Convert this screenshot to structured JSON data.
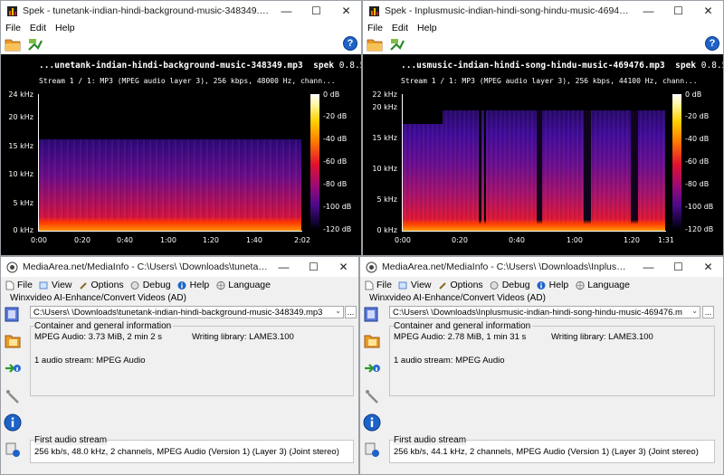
{
  "spek_left": {
    "title": "Spek - tunetank-indian-hindi-background-music-348349.mp3",
    "menu": [
      "File",
      "Edit",
      "Help"
    ],
    "file_header": "...unetank-indian-hindi-background-music-348349.mp3",
    "app_name": "spek",
    "version": "0.8.5",
    "stream_info": "Stream 1 / 1: MP3 (MPEG audio layer 3), 256 kbps, 48000 Hz, chann...",
    "y_ticks": [
      "24 kHz",
      "20 kHz",
      "15 kHz",
      "10 kHz",
      "5 kHz",
      "0 kHz"
    ],
    "x_ticks": [
      "0:00",
      "0:20",
      "0:40",
      "1:00",
      "1:20",
      "1:40",
      "2:02"
    ],
    "db_ticks": [
      "0 dB",
      "-20 dB",
      "-40 dB",
      "-60 dB",
      "-80 dB",
      "-100 dB",
      "-120 dB"
    ],
    "cutoff_khz": 16
  },
  "spek_right": {
    "title": "Spek - Inplusmusic-indian-hindi-song-hindu-music-469476.mp3",
    "menu": [
      "File",
      "Edit",
      "Help"
    ],
    "file_header": "...usmusic-indian-hindi-song-hindu-music-469476.mp3",
    "app_name": "spek",
    "version": "0.8.5",
    "stream_info": "Stream 1 / 1: MP3 (MPEG audio layer 3), 256 kbps, 44100 Hz, chann...",
    "y_ticks": [
      "22 kHz",
      "20 kHz",
      "15 kHz",
      "10 kHz",
      "5 kHz",
      "0 kHz"
    ],
    "x_ticks": [
      "0:00",
      "0:20",
      "0:40",
      "1:00",
      "1:20",
      "1:31"
    ],
    "db_ticks": [
      "0 dB",
      "-20 dB",
      "-40 dB",
      "-60 dB",
      "-80 dB",
      "-100 dB",
      "-120 dB"
    ],
    "cutoff_khz": 19.5
  },
  "mi_left": {
    "title": "MediaArea.net/MediaInfo - C:\\Users\\        \\Downloads\\tunetank-indi...",
    "menu": [
      "File",
      "View",
      "Options",
      "Debug",
      "Help",
      "Language"
    ],
    "ad": "Winxvideo AI-Enhance/Convert Videos (AD)",
    "path": "C:\\Users\\        \\Downloads\\tunetank-indian-hindi-background-music-348349.mp3",
    "general_title": "Container and general information",
    "general_line": "MPEG Audio: 3.73 MiB, 2 min 2 s",
    "writing_library": "Writing library: LAME3.100",
    "streams": "1 audio stream: MPEG Audio",
    "audio_title": "First audio stream",
    "audio_line": "256 kb/s, 48.0 kHz, 2 channels, MPEG Audio (Version 1) (Layer 3) (Joint stereo)"
  },
  "mi_right": {
    "title": "MediaArea.net/MediaInfo - C:\\Users\\        \\Downloads\\Inplusmusic-i...",
    "menu": [
      "File",
      "View",
      "Options",
      "Debug",
      "Help",
      "Language"
    ],
    "ad": "Winxvideo AI-Enhance/Convert Videos (AD)",
    "path": "C:\\Users\\        \\Downloads\\Inplusmusic-indian-hindi-song-hindu-music-469476.m",
    "general_title": "Container and general information",
    "general_line": "MPEG Audio: 2.78 MiB, 1 min 31 s",
    "writing_library": "Writing library: LAME3.100",
    "streams": "1 audio stream: MPEG Audio",
    "audio_title": "First audio stream",
    "audio_line": "256 kb/s, 44.1 kHz, 2 channels, MPEG Audio (Version 1) (Layer 3) (Joint stereo)"
  },
  "icons": {
    "window_minimize": "—",
    "window_maximize": "☐",
    "window_close": "✕",
    "help": "?",
    "dropdown": "⌄",
    "more": "..."
  },
  "colors": {
    "spek_background": "#000000",
    "help_blue": "#1e63c8",
    "mediainfo_bg": "#f0f0f0"
  }
}
